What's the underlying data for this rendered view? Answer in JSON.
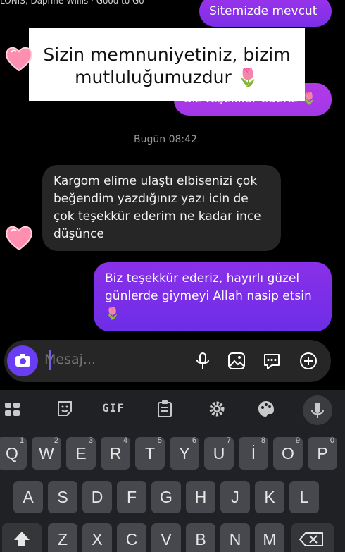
{
  "header": {
    "partial_text": "LONIS, Daphne Willis · Good to Go"
  },
  "messages": [
    {
      "id": "m1",
      "side": "out",
      "text": "Sitemizde mevcut"
    },
    {
      "id": "m2",
      "side": "out",
      "text": "Biz teşekkür ederiz 🌷"
    },
    {
      "id": "m3",
      "side": "in",
      "lines": [
        "Kargom elime ulaştı elbisenizi çok",
        "beğendim yazdığınız yazı icin de",
        "çok teşekkür ederim ne kadar ince",
        "düşünce"
      ]
    },
    {
      "id": "m4",
      "side": "out",
      "lines": [
        "Biz teşekkür ederiz, hayırlı güzel",
        "günlerde giymeyi Allah nasip etsin",
        "🌷"
      ]
    }
  ],
  "banner": {
    "line1": "Sizin memnuniyetiniz, bizim",
    "line2": "mutluluğumuzdur 🌷"
  },
  "timestamp": "Bugün 08:42",
  "composer": {
    "placeholder": "Mesaj..."
  },
  "keyboard": {
    "toolbar": [
      "apps-icon",
      "sticker-icon",
      "GIF",
      "clipboard-icon",
      "settings-icon",
      "palette-icon",
      "mic-icon"
    ],
    "gif_label": "GIF",
    "row1": [
      {
        "k": "Q",
        "n": "1"
      },
      {
        "k": "W",
        "n": "2"
      },
      {
        "k": "E",
        "n": "3"
      },
      {
        "k": "R",
        "n": "4"
      },
      {
        "k": "T",
        "n": "5"
      },
      {
        "k": "Y",
        "n": "6"
      },
      {
        "k": "U",
        "n": "7"
      },
      {
        "k": "İ",
        "n": "8"
      },
      {
        "k": "O",
        "n": "9"
      },
      {
        "k": "P",
        "n": "0"
      }
    ],
    "row2": [
      "A",
      "S",
      "D",
      "F",
      "G",
      "H",
      "J",
      "K",
      "L"
    ],
    "row3": [
      "Z",
      "X",
      "C",
      "V",
      "B",
      "N",
      "M"
    ]
  },
  "colors": {
    "accent": "#6a3df2",
    "bubble_out": "#7d2ee8",
    "bubble_in": "#262626",
    "key": "#46484d"
  }
}
